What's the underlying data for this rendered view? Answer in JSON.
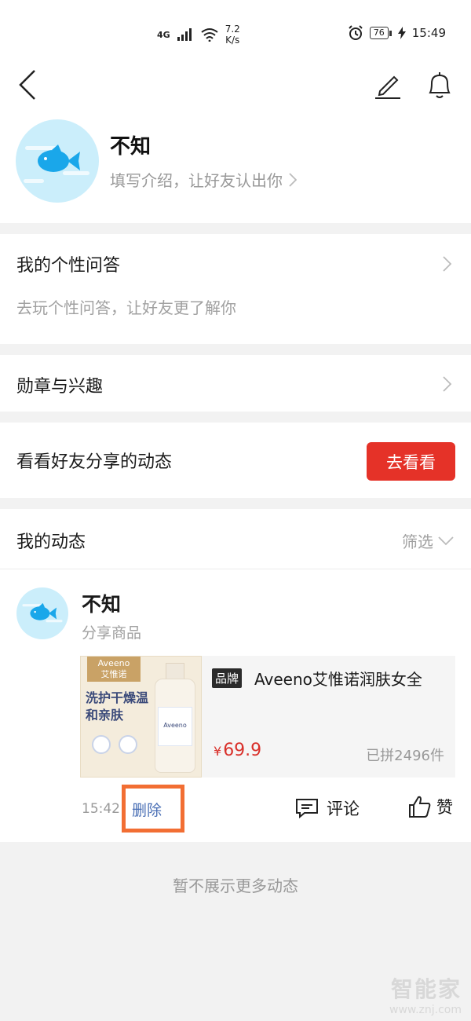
{
  "status_bar": {
    "network": "4G",
    "speed_value": "7.2",
    "speed_unit": "K/s",
    "battery": "76",
    "time": "15:49"
  },
  "icons": {
    "back": "back-arrow-icon",
    "edit": "pencil-icon",
    "notifications": "bell-icon",
    "chevron": "chevron-right-icon",
    "filter": "chevron-down-icon",
    "comment": "comment-icon",
    "like": "thumbs-up-icon"
  },
  "profile": {
    "name": "不知",
    "intro": "填写介绍，让好友认出你"
  },
  "qa": {
    "title": "我的个性问答",
    "subtitle": "去玩个性问答，让好友更了解你"
  },
  "medals": {
    "title": "勋章与兴趣"
  },
  "friends": {
    "title": "看看好友分享的动态",
    "button": "去看看"
  },
  "my_posts": {
    "title": "我的动态",
    "filter": "筛选",
    "post": {
      "author": "不知",
      "type": "分享商品",
      "time": "15:42",
      "delete": "删除",
      "comment": "评论",
      "like": "赞",
      "product": {
        "image_brand": "Aveeno",
        "image_brand_cn": "艾惟诺",
        "image_text": "洗护干燥温和亲肤",
        "image_bottle_text": "Aveeno",
        "tag": "品牌",
        "title": "Aveeno艾惟诺润肤女全",
        "currency": "¥",
        "price": "69.9",
        "sold": "已拼2496件"
      }
    }
  },
  "footer": {
    "no_more": "暂不展示更多动态"
  },
  "watermark": {
    "name": "智能家",
    "url": "www.znj.com"
  },
  "colors": {
    "accent_red": "#e53228",
    "price_red": "#d9302a",
    "link_blue": "#4a6fb5",
    "highlight_orange": "#f26e33",
    "avatar_bg": "#cbeefb",
    "fish_blue": "#1aa7ea"
  }
}
